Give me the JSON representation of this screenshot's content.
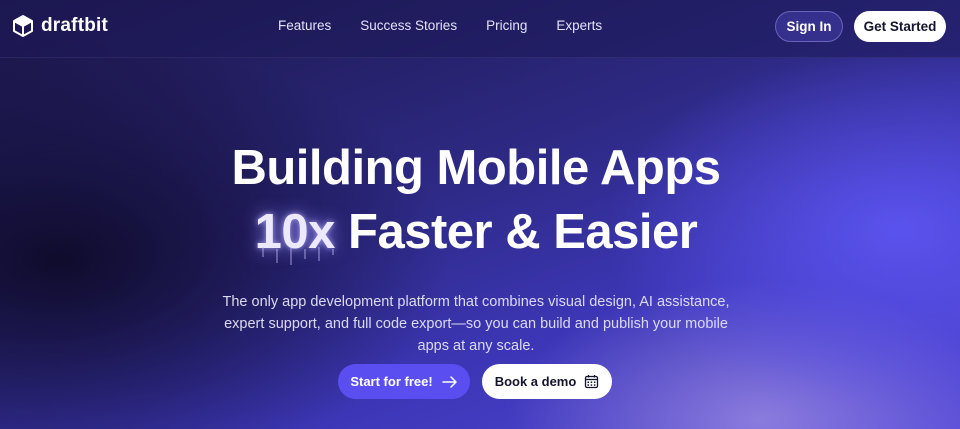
{
  "brand": {
    "name": "draftbit",
    "logo_icon": "cube-logo-icon"
  },
  "nav": {
    "items": [
      {
        "label": "Features"
      },
      {
        "label": "Success Stories"
      },
      {
        "label": "Pricing"
      },
      {
        "label": "Experts"
      }
    ],
    "sign_in": "Sign In",
    "get_started": "Get Started"
  },
  "hero": {
    "headline_line1": "Building Mobile Apps",
    "headline_accent": "10x",
    "headline_line2_rest": " Faster & Easier",
    "subtitle": "The only app development platform that combines visual design, AI assistance, expert support, and full code export—so you can build and publish your mobile apps at any scale.",
    "cta_primary": "Start for free!",
    "cta_primary_icon": "arrow-right-icon",
    "cta_secondary": "Book a demo",
    "cta_secondary_icon": "calendar-icon"
  },
  "colors": {
    "primary_button": "#5a4ef0",
    "background_dark": "#1b1646",
    "background_accent": "#5448d8"
  }
}
